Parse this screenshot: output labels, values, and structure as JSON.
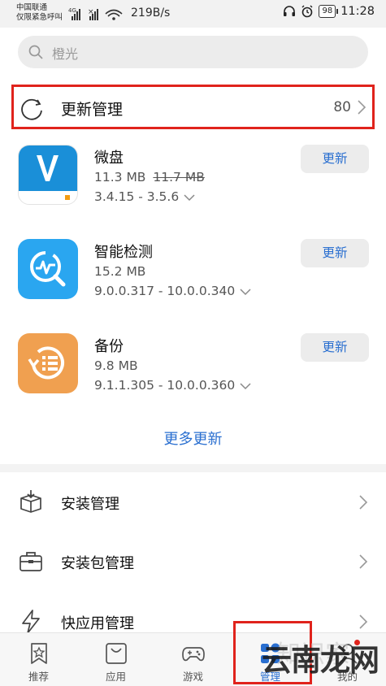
{
  "status_bar": {
    "carrier_line1": "中国联通",
    "carrier_line2": "仅限紧急呼叫",
    "network": "4G",
    "speed": "219B/s",
    "battery": "98",
    "time": "11:28"
  },
  "search": {
    "placeholder": "橙光",
    "icon": "search-icon"
  },
  "updates_header": {
    "title": "更新管理",
    "count": "80",
    "icon": "refresh-icon"
  },
  "apps": [
    {
      "name": "微盘",
      "size": "11.3 MB",
      "old_size": "11.7 MB",
      "version": "3.4.15 - 3.5.6",
      "button": "更新",
      "icon": "weipan-app-icon"
    },
    {
      "name": "智能检测",
      "size": "15.2 MB",
      "old_size": "",
      "version": "9.0.0.317 - 10.0.0.340",
      "button": "更新",
      "icon": "smart-detect-app-icon"
    },
    {
      "name": "备份",
      "size": "9.8 MB",
      "old_size": "",
      "version": "9.1.1.305 - 10.0.0.360",
      "button": "更新",
      "icon": "backup-app-icon"
    }
  ],
  "more_updates": "更多更新",
  "menu": [
    {
      "label": "安装管理",
      "icon": "package-icon"
    },
    {
      "label": "安装包管理",
      "icon": "briefcase-icon"
    },
    {
      "label": "快应用管理",
      "icon": "lightning-icon"
    }
  ],
  "bottom_nav": [
    {
      "label": "推荐",
      "icon": "bookmark-star-icon",
      "active": false
    },
    {
      "label": "应用",
      "icon": "bag-icon",
      "active": false
    },
    {
      "label": "游戏",
      "icon": "gamepad-icon",
      "active": false
    },
    {
      "label": "管理",
      "icon": "grid-icon",
      "active": true
    },
    {
      "label": "我的",
      "icon": "profile-icon",
      "active": false
    }
  ],
  "watermark": {
    "text": "云南龙网",
    "faint_text": "知识家"
  },
  "colors": {
    "accent": "#2a6fd0",
    "highlight_box": "#e0231c",
    "weipan": "#1a8fd8",
    "smart_detect": "#2aa6f0",
    "backup": "#f0a050"
  }
}
